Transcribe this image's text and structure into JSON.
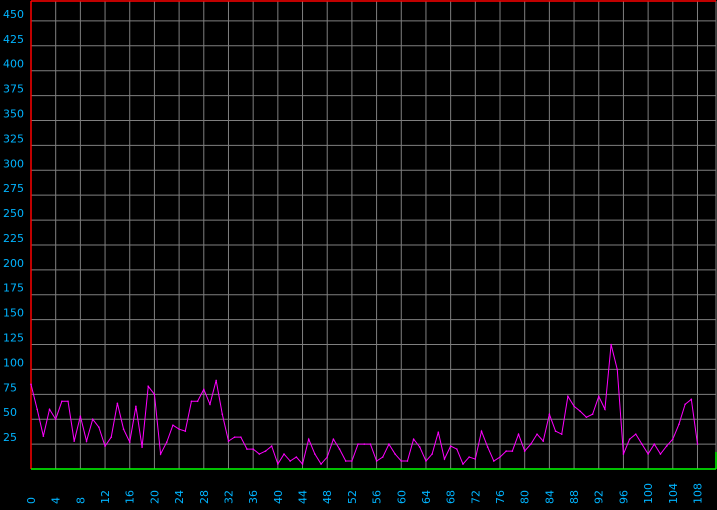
{
  "colors": {
    "background": "#000000",
    "grid": "#7f7f7f",
    "series": "#ff00ff",
    "tick_label": "#00b4ff",
    "top_border": "#ff0000",
    "baseline": "#00ff00"
  },
  "chart_data": {
    "type": "line",
    "title": "",
    "xlabel": "",
    "ylabel": "",
    "ylim": [
      0,
      470
    ],
    "xlim": [
      0,
      111
    ],
    "grid": true,
    "legend": "none",
    "y_ticks": [
      25,
      50,
      75,
      100,
      125,
      150,
      175,
      200,
      225,
      250,
      275,
      300,
      325,
      350,
      375,
      400,
      425,
      450
    ],
    "x_ticks": [
      0,
      4,
      8,
      12,
      16,
      20,
      24,
      28,
      32,
      36,
      40,
      44,
      48,
      52,
      56,
      60,
      64,
      68,
      72,
      76,
      80,
      84,
      88,
      92,
      96,
      100,
      104,
      108
    ],
    "y_tick_labels": [
      "25",
      "50",
      "75",
      "100",
      "125",
      "150",
      "175",
      "200",
      "225",
      "250",
      "275",
      "300",
      "325",
      "350",
      "375",
      "400",
      "425",
      "450"
    ],
    "x_tick_labels": [
      "0",
      "4",
      "8",
      "12",
      "16",
      "20",
      "24",
      "28",
      "32",
      "36",
      "40",
      "44",
      "48",
      "52",
      "56",
      "60",
      "64",
      "68",
      "72",
      "76",
      "80",
      "84",
      "88",
      "92",
      "96",
      "100",
      "104",
      "108"
    ],
    "series": [
      {
        "values": [
          85,
          60,
          33,
          60,
          50,
          68,
          68,
          28,
          53,
          28,
          50,
          42,
          23,
          32,
          66,
          40,
          27,
          63,
          22,
          83,
          75,
          15,
          27,
          44,
          40,
          38,
          68,
          68,
          80,
          65,
          89,
          55,
          28,
          32,
          32,
          20,
          20,
          15,
          18,
          23,
          5,
          15,
          8,
          12,
          5,
          30,
          15,
          5,
          12,
          30,
          20,
          8,
          8,
          25,
          25,
          25,
          8,
          12,
          25,
          15,
          8,
          8,
          30,
          22,
          8,
          15,
          37,
          10,
          23,
          20,
          5,
          12,
          10,
          38,
          22,
          8,
          12,
          18,
          18,
          35,
          18,
          25,
          35,
          28,
          55,
          38,
          35,
          73,
          63,
          58,
          52,
          55,
          73,
          60,
          125,
          100,
          15,
          30,
          35,
          25,
          15,
          25,
          15,
          23,
          30,
          45,
          65,
          70,
          25
        ]
      }
    ]
  }
}
